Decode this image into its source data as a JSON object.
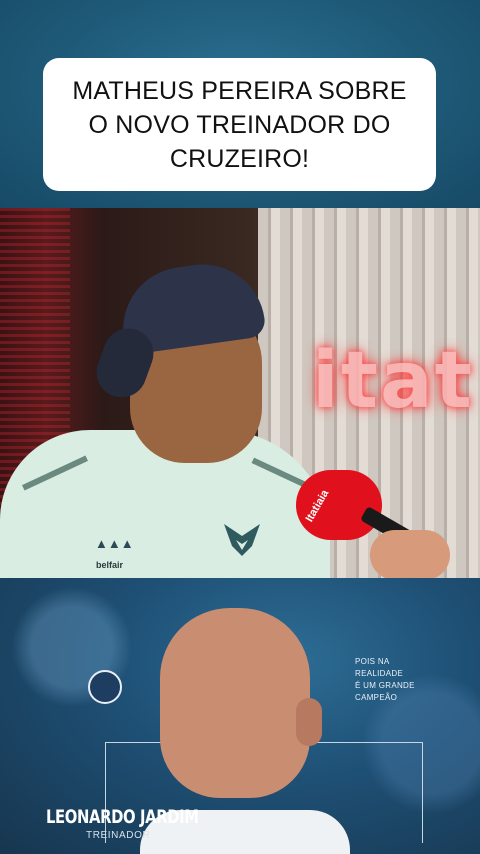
{
  "headline": {
    "text": "MATHEUS PEREIRA SOBRE\nO NOVO TREINADOR DO\nCRUZEIRO!"
  },
  "interview": {
    "neon_sign": "itat",
    "shirt_brand": "belfair",
    "mic_label": "Itatiaia"
  },
  "coach_card": {
    "quote_lines": [
      "POIS NA",
      "REALIDADE",
      "É UM GRANDE",
      "CAMPEÃO"
    ],
    "name": "LEONARDO JARDIM",
    "role": "TREINADOR"
  },
  "colors": {
    "background": "#1f5775",
    "card": "#ffffff",
    "mic_red": "#e0101c"
  }
}
